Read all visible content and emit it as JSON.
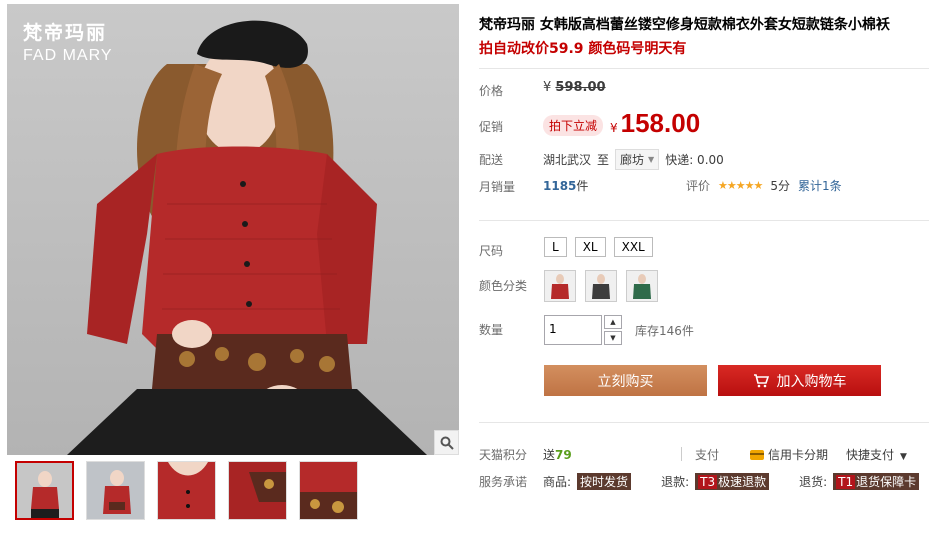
{
  "brand": {
    "cn": "梵帝玛丽",
    "en": "FAD MARY"
  },
  "product": {
    "title": "梵帝玛丽 女韩版高档蕾丝镂空修身短款棉衣外套女短款链条小棉袄",
    "subtitle": "拍自动改价59.9 颜色码号明天有"
  },
  "price": {
    "label": "价格",
    "currency": "¥",
    "original": "598.00",
    "promo_label": "促销",
    "promo_badge": "拍下立减",
    "current": "158.00"
  },
  "shipping": {
    "label": "配送",
    "from": "湖北武汉",
    "to_word": "至",
    "destination": "廊坊",
    "fee": "快递: 0.00"
  },
  "sales": {
    "label": "月销量",
    "count": "1185",
    "unit": "件",
    "rating_label": "评价",
    "stars": "★★★★★",
    "score": "5分",
    "review_count": "累计1条"
  },
  "size": {
    "label": "尺码",
    "options": [
      "L",
      "XL",
      "XXL"
    ]
  },
  "color": {
    "label": "颜色分类",
    "swatches": [
      "#b52a2a",
      "#3d3d3d",
      "#2f6b4a"
    ]
  },
  "quantity": {
    "label": "数量",
    "value": "1",
    "stock": "库存146件"
  },
  "actions": {
    "buy": "立刻购买",
    "cart": "加入购物车"
  },
  "points": {
    "label": "天猫积分",
    "value_prefix": "送",
    "value": "79"
  },
  "payment": {
    "label": "支付",
    "card": "信用卡分期",
    "fast": "快捷支付"
  },
  "service": {
    "label": "服务承诺",
    "goods_prefix": "商品:",
    "goods_tag": "按时发货",
    "refund_prefix": "退款:",
    "refund_badge": "T3",
    "refund_tag": "极速退款",
    "return_prefix": "退货:",
    "return_badge": "T1",
    "return_tag": "退货保障卡"
  },
  "colors": {
    "accent": "#c40000",
    "buy": "#c8865a",
    "cart": "#c8191a",
    "link": "#336699"
  }
}
